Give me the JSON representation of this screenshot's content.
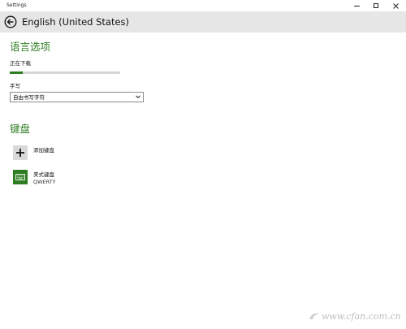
{
  "window": {
    "title": "Settings"
  },
  "header": {
    "title": "English (United States)"
  },
  "language_options": {
    "section_title": "语言选项",
    "download_status": "正在下载",
    "download_progress_percent": 12,
    "handwriting_label": "手写",
    "handwriting_select_value": "自由书写字符"
  },
  "keyboard": {
    "section_title": "键盘",
    "add_keyboard_label": "添加键盘",
    "installed": {
      "name": "美式键盘",
      "layout": "QWERTY"
    }
  },
  "watermark": {
    "text": "www.cfan.com.cn"
  },
  "colors": {
    "accent": "#2e7d23",
    "header_bg": "#e6e6e6",
    "add_tile_bg": "#d9d9d9"
  },
  "icons": {
    "back": "back-arrow-icon",
    "minimize": "minimize-icon",
    "maximize": "maximize-icon",
    "close": "close-icon",
    "chevron": "chevron-down-icon",
    "add": "plus-icon",
    "keyboard": "keyboard-icon"
  }
}
